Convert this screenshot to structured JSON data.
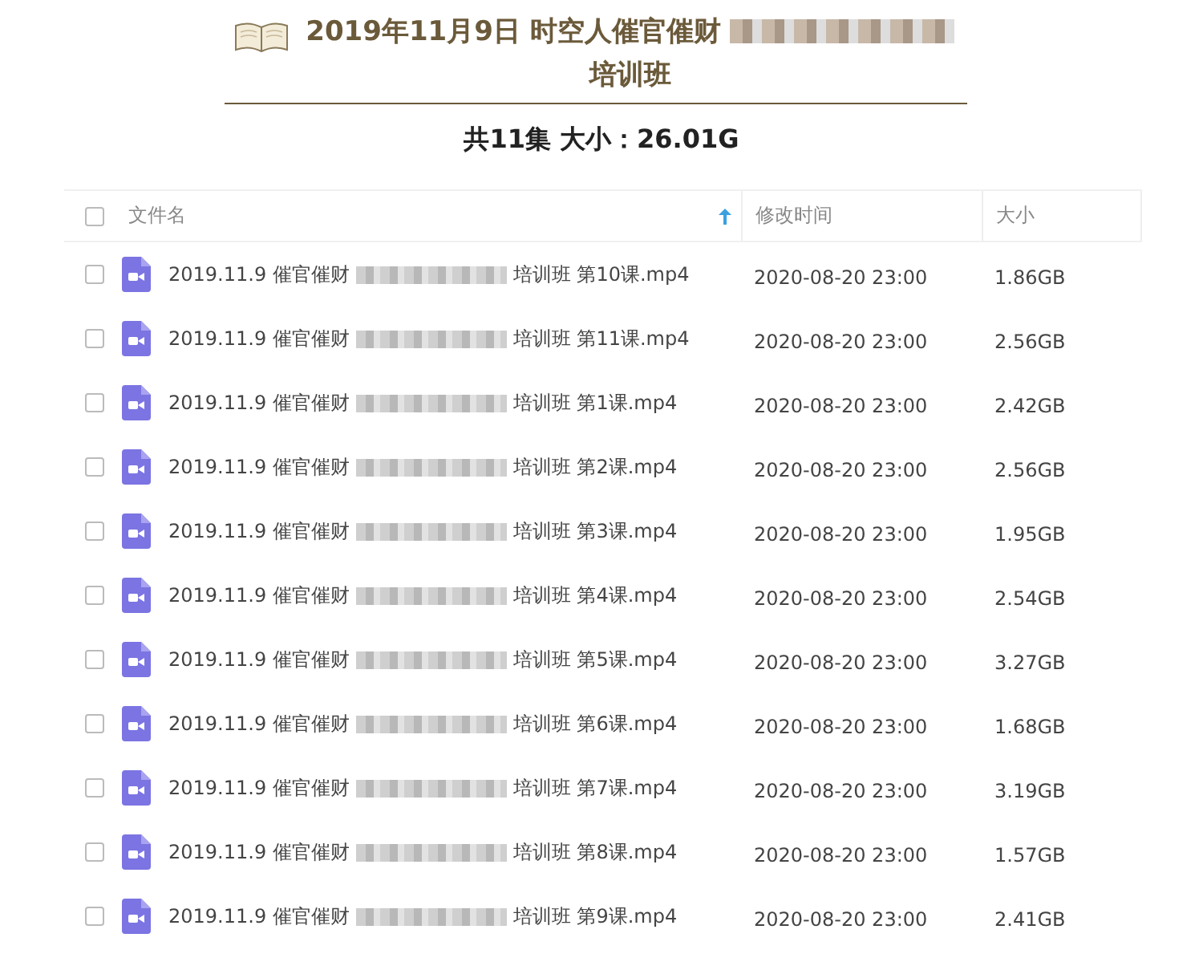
{
  "title": {
    "line1": "2019年11月9日 时空人催官催财",
    "line2": "培训班"
  },
  "summary": "共11集 大小：26.01G",
  "table": {
    "header_checked": false,
    "columns": [
      {
        "label": "文件名",
        "sorted": true
      },
      {
        "label": "修改时间",
        "sorted": false
      },
      {
        "label": "大小",
        "sorted": false
      }
    ],
    "rows": [
      {
        "checked": false,
        "name_prefix": "2019.11.9 催官催财",
        "name_suffix": "培训班 第10课.mp4",
        "modified": "2020-08-20 23:00",
        "size": "1.86GB"
      },
      {
        "checked": false,
        "name_prefix": "2019.11.9 催官催财",
        "name_suffix": "培训班 第11课.mp4",
        "modified": "2020-08-20 23:00",
        "size": "2.56GB"
      },
      {
        "checked": false,
        "name_prefix": "2019.11.9 催官催财",
        "name_suffix": "培训班 第1课.mp4",
        "modified": "2020-08-20 23:00",
        "size": "2.42GB"
      },
      {
        "checked": false,
        "name_prefix": "2019.11.9 催官催财",
        "name_suffix": "培训班 第2课.mp4",
        "modified": "2020-08-20 23:00",
        "size": "2.56GB"
      },
      {
        "checked": false,
        "name_prefix": "2019.11.9 催官催财",
        "name_suffix": "培训班 第3课.mp4",
        "modified": "2020-08-20 23:00",
        "size": "1.95GB"
      },
      {
        "checked": false,
        "name_prefix": "2019.11.9 催官催财",
        "name_suffix": "培训班 第4课.mp4",
        "modified": "2020-08-20 23:00",
        "size": "2.54GB"
      },
      {
        "checked": false,
        "name_prefix": "2019.11.9 催官催财",
        "name_suffix": "培训班 第5课.mp4",
        "modified": "2020-08-20 23:00",
        "size": "3.27GB"
      },
      {
        "checked": false,
        "name_prefix": "2019.11.9 催官催财",
        "name_suffix": "培训班 第6课.mp4",
        "modified": "2020-08-20 23:00",
        "size": "1.68GB"
      },
      {
        "checked": false,
        "name_prefix": "2019.11.9 催官催财",
        "name_suffix": "培训班 第7课.mp4",
        "modified": "2020-08-20 23:00",
        "size": "3.19GB"
      },
      {
        "checked": false,
        "name_prefix": "2019.11.9 催官催财",
        "name_suffix": "培训班 第8课.mp4",
        "modified": "2020-08-20 23:00",
        "size": "1.57GB"
      },
      {
        "checked": false,
        "name_prefix": "2019.11.9 催官催财",
        "name_suffix": "培训班 第9课.mp4",
        "modified": "2020-08-20 23:00",
        "size": "2.41GB"
      }
    ]
  }
}
